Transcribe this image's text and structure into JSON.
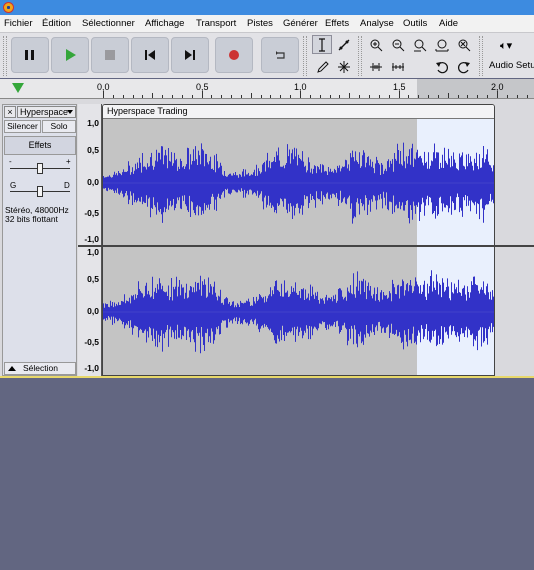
{
  "menu": [
    "Fichier",
    "Édition",
    "Sélectionner",
    "Affichage",
    "Transport",
    "Pistes",
    "Générer",
    "Effets",
    "Analyse",
    "Outils",
    "Aide"
  ],
  "toolbar": {
    "transport": [
      "pause-icon",
      "play-icon",
      "stop-icon",
      "skip-start-icon",
      "skip-end-icon",
      "record-icon",
      "loop-icon"
    ],
    "tools": [
      "selection-tool-icon",
      "envelope-tool-icon",
      "zoom-in-icon",
      "zoom-out-icon",
      "fit-selection-icon",
      "fit-project-icon",
      "zoom-toggle-icon",
      "draw-tool-icon",
      "multi-tool-icon",
      "trim-outside-icon",
      "silence-selection-icon",
      "undo-icon",
      "redo-icon"
    ],
    "audio_setup_label": "Audio Setup",
    "audio_setup_icon": "speaker-icon"
  },
  "ruler": {
    "labels": [
      "0,0",
      "0,5",
      "1,0",
      "1,5",
      "2,0"
    ]
  },
  "track": {
    "name": "Hyperspace",
    "close_label": "×",
    "mute_label": "Silencer",
    "solo_label": "Solo",
    "effects_label": "Effets",
    "gain_minus": "-",
    "gain_plus": "+",
    "pan_left": "G",
    "pan_right": "D",
    "info_line1": "Stéréo, 48000Hz",
    "info_line2": "32 bits flottant",
    "select_label": "Sélection",
    "clip_name": "Hyperspace Trading",
    "scale_labels": [
      "1,0",
      "0,5",
      "0,0",
      "-0,5",
      "-1,0"
    ]
  },
  "colors": {
    "titlebar": "#3d8be0",
    "waveform": "#3232c8",
    "clip_background": "#c4c4c4",
    "selection": "#e9f0fd",
    "record": "#cc3333",
    "play": "#34a63a",
    "workspace": "#626681"
  }
}
